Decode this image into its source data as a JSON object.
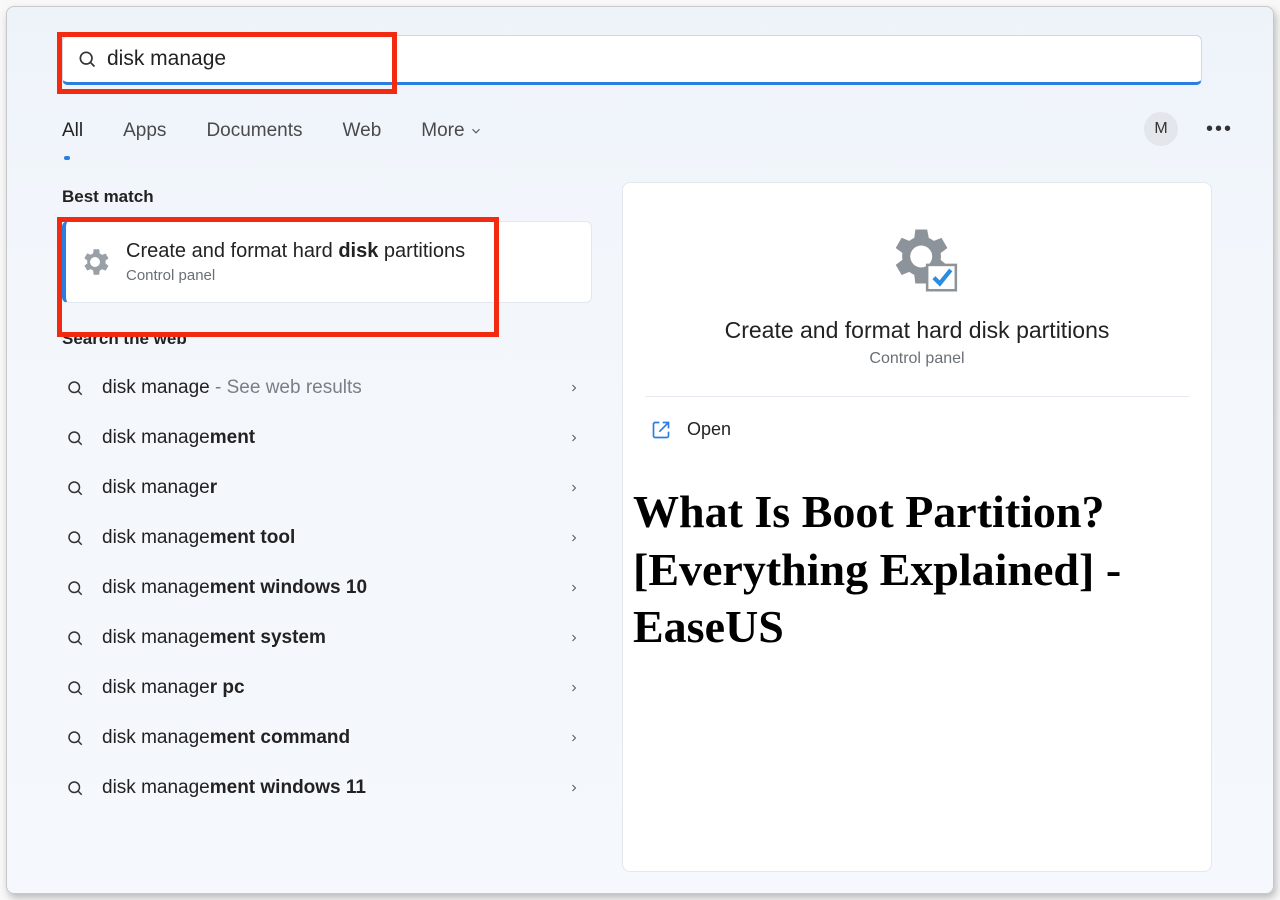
{
  "search": {
    "query": "disk manage"
  },
  "tabs": {
    "items": [
      "All",
      "Apps",
      "Documents",
      "Web",
      "More"
    ],
    "active": "All"
  },
  "topRight": {
    "avatar_initial": "M"
  },
  "left": {
    "best_match_label": "Best match",
    "best_match": {
      "title_prefix": "Create and format hard ",
      "title_bold": "disk",
      "title_suffix": " partitions",
      "subtitle": "Control panel"
    },
    "search_web_label": "Search the web",
    "web_items": [
      {
        "plain": "disk manage",
        "bold": "",
        "hint": " - See web results"
      },
      {
        "plain": "disk manage",
        "bold": "ment",
        "hint": ""
      },
      {
        "plain": "disk manage",
        "bold": "r",
        "hint": ""
      },
      {
        "plain": "disk manage",
        "bold": "ment tool",
        "hint": ""
      },
      {
        "plain": "disk manage",
        "bold": "ment windows 10",
        "hint": ""
      },
      {
        "plain": "disk manage",
        "bold": "ment system",
        "hint": ""
      },
      {
        "plain": "disk manage",
        "bold": "r pc",
        "hint": ""
      },
      {
        "plain": "disk manage",
        "bold": "ment command",
        "hint": ""
      },
      {
        "plain": "disk manage",
        "bold": "ment windows 11",
        "hint": ""
      }
    ]
  },
  "right": {
    "title": "Create and format hard disk partitions",
    "subtitle": "Control panel",
    "open_label": "Open",
    "overlay_heading": "What Is Boot Partition? [Everything Explained] - EaseUS"
  }
}
